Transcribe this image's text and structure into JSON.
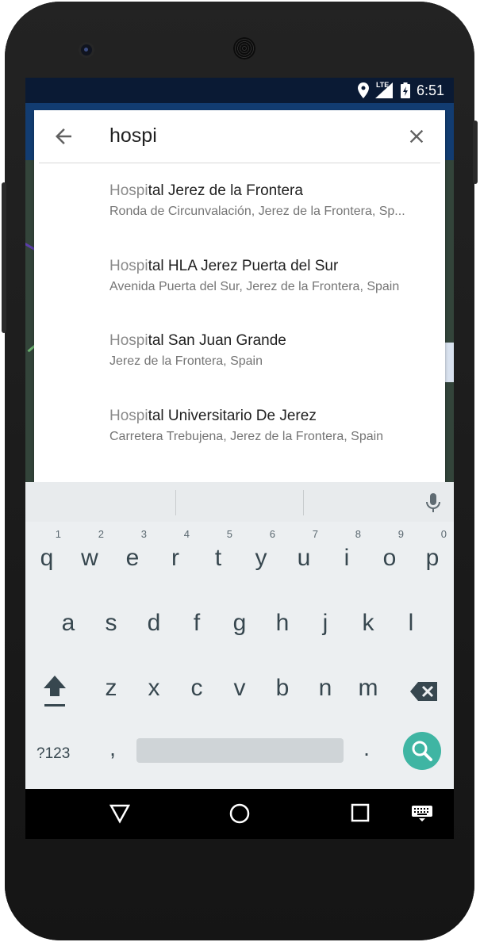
{
  "status_bar": {
    "network": "LTE",
    "time": "6:51"
  },
  "search": {
    "query": "hospi",
    "back_icon": "arrow-left-icon",
    "clear_icon": "close-icon"
  },
  "results": [
    {
      "highlight": "Hospi",
      "rest": "tal Jerez de la Frontera",
      "subtitle": "Ronda de Circunvalación, Jerez de la Frontera, Sp..."
    },
    {
      "highlight": "Hospi",
      "rest": "tal HLA Jerez Puerta del Sur",
      "subtitle": "Avenida Puerta del Sur, Jerez de la Frontera, Spain"
    },
    {
      "highlight": "Hospi",
      "rest": "tal San Juan Grande",
      "subtitle": "Jerez de la Frontera, Spain"
    },
    {
      "highlight": "Hospi",
      "rest": "tal Universitario De Jerez",
      "subtitle": "Carretera Trebujena, Jerez de la Frontera, Spain"
    }
  ],
  "keyboard": {
    "row1": [
      {
        "ch": "q",
        "hint": "1"
      },
      {
        "ch": "w",
        "hint": "2"
      },
      {
        "ch": "e",
        "hint": "3"
      },
      {
        "ch": "r",
        "hint": "4"
      },
      {
        "ch": "t",
        "hint": "5"
      },
      {
        "ch": "y",
        "hint": "6"
      },
      {
        "ch": "u",
        "hint": "7"
      },
      {
        "ch": "i",
        "hint": "8"
      },
      {
        "ch": "o",
        "hint": "9"
      },
      {
        "ch": "p",
        "hint": "0"
      }
    ],
    "row2": [
      "a",
      "s",
      "d",
      "f",
      "g",
      "h",
      "j",
      "k",
      "l"
    ],
    "row3": [
      "z",
      "x",
      "c",
      "v",
      "b",
      "n",
      "m"
    ],
    "symbols_label": "?123",
    "comma": ",",
    "period": ".",
    "colors": {
      "background": "#eceff1",
      "action_key": "#3fb5a3",
      "key_text": "#37474f"
    }
  },
  "colors": {
    "status_bar": "#0a1a34",
    "app_bar": "#123c71"
  },
  "nav": {
    "back": "back-triangle-icon",
    "home": "home-circle-icon",
    "recents": "recents-square-icon",
    "keyboard": "keyboard-icon"
  }
}
